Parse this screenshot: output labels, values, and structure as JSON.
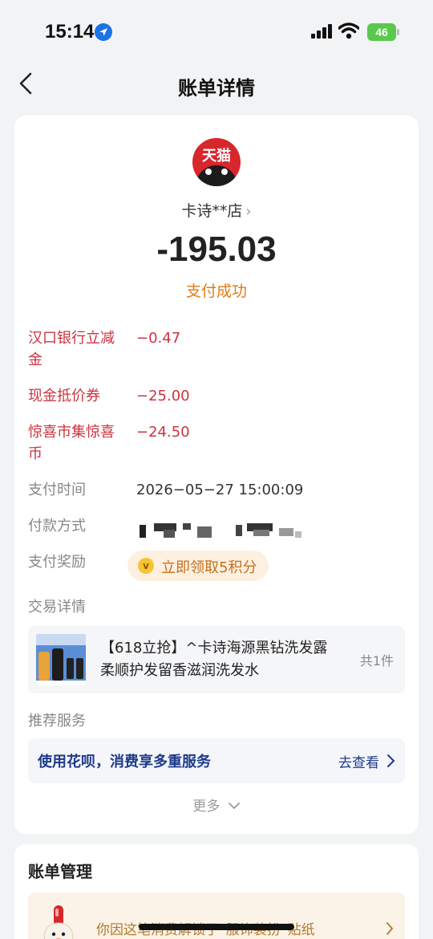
{
  "status_bar": {
    "time": "15:14",
    "battery": "46"
  },
  "nav": {
    "title": "账单详情"
  },
  "merchant": {
    "logo_text": "天猫",
    "name": "卡诗**店",
    "amount": "-195.03",
    "status": "支付成功"
  },
  "discounts": [
    {
      "label": "汉口银行立减金",
      "value": "−0.47"
    },
    {
      "label": "现金抵价券",
      "value": "−25.00"
    },
    {
      "label": "惊喜市集惊喜币",
      "value": "−24.50"
    }
  ],
  "details": {
    "pay_time_label": "支付时间",
    "pay_time_value": "2026−05−27 15:00:09",
    "pay_method_label": "付款方式",
    "reward_label": "支付奖励",
    "reward_button": "立即领取5积分"
  },
  "transaction": {
    "section_title": "交易详情",
    "product_title": "【618立抢】^卡诗海源黑钻洗发露柔顺护发留香滋润洗发水",
    "product_count": "共1件"
  },
  "recommend": {
    "section_title": "推荐服务",
    "service_text": "使用花呗，消费享多重服务",
    "service_link": "去查看",
    "more": "更多"
  },
  "bill_manage": {
    "title": "账单管理",
    "banner_text": "你因这笔消费解锁了“服饰装扮”贴纸"
  },
  "colors": {
    "accent_orange": "#e07b12",
    "discount_red": "#cc3340",
    "link_blue": "#1e3a8a",
    "tmall_red": "#d8262d"
  }
}
